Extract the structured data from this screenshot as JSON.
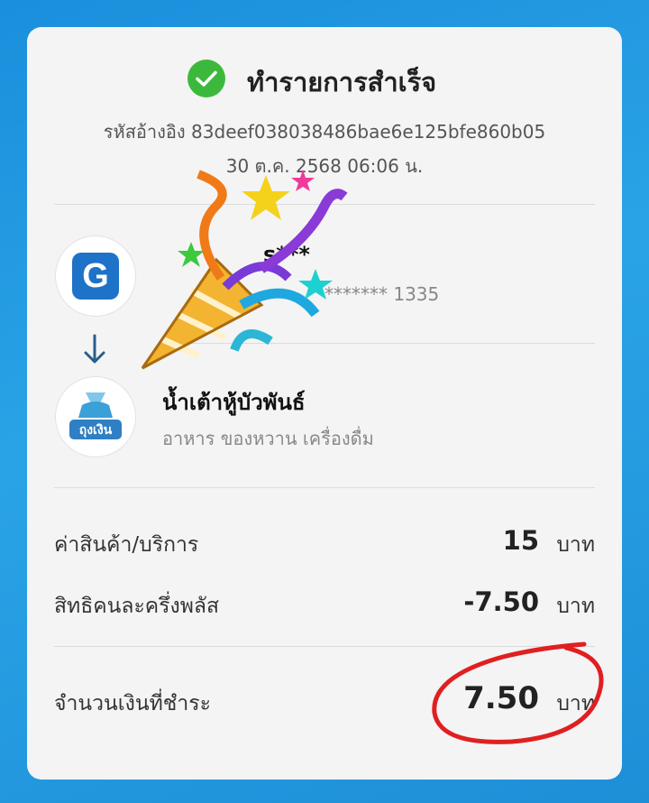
{
  "header": {
    "title": "ทำรายการสำเร็จ",
    "reference": "รหัสอ้างอิง 83deef038038486bae6e125bfe860b05",
    "datetime": "30 ต.ค. 2568 06:06 น."
  },
  "sender": {
    "name_visible": "s***",
    "account_visible": "******* 1335",
    "avatar_letter": "G"
  },
  "receiver": {
    "name": "น้ำเต้าหู้บัวพันธ์",
    "category": "อาหาร ของหวาน เครื่องดื่ม",
    "logo_text": "ถุงเงิน"
  },
  "summary": {
    "price_label": "ค่าสินค้า/บริการ",
    "price_value": "15",
    "discount_label": "สิทธิคนละครึ่งพลัส",
    "discount_value": "-7.50",
    "total_label": "จำนวนเงินที่ชำระ",
    "total_value": "7.50",
    "unit": "บาท"
  },
  "colors": {
    "success_green": "#3cb93c",
    "background_blue": "#2aa3e6",
    "logo_blue": "#1e72c8",
    "annotation_red": "#e02020"
  },
  "icons": {
    "status": "check-circle-icon",
    "flow": "arrow-down-icon",
    "celebration": "party-popper-icon"
  }
}
